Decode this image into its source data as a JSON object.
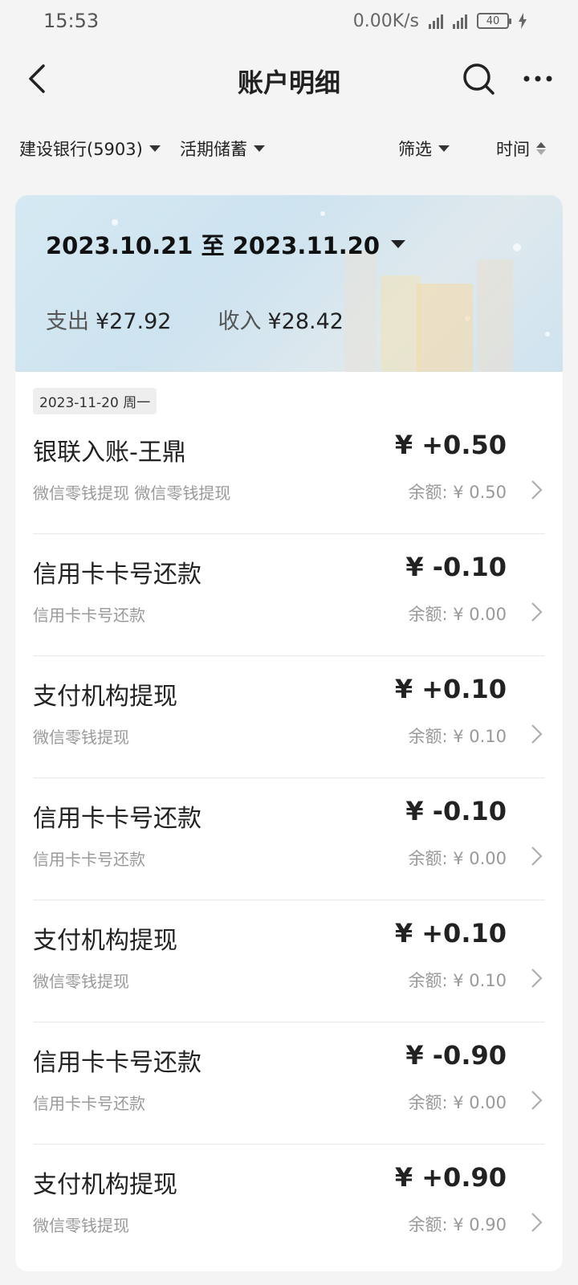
{
  "status": {
    "time": "15:53",
    "speed": "0.00K/s",
    "battery": "40"
  },
  "nav": {
    "title": "账户明细"
  },
  "filters": {
    "bank": "建设银行(5903)",
    "type": "活期储蓄",
    "filter": "筛选",
    "time": "时间"
  },
  "summary": {
    "range": "2023.10.21 至 2023.11.20",
    "expense_label": "支出",
    "expense": "¥27.92",
    "income_label": "收入",
    "income": "¥28.42"
  },
  "date_group": "2023-11-20 周一",
  "transactions": [
    {
      "name": "银联入账-王鼎",
      "sub": "微信零钱提现 微信零钱提现",
      "amount": "¥ +0.50",
      "balance": "余额: ¥ 0.50"
    },
    {
      "name": "信用卡卡号还款",
      "sub": "信用卡卡号还款",
      "amount": "¥ -0.10",
      "balance": "余额: ¥ 0.00"
    },
    {
      "name": "支付机构提现",
      "sub": "微信零钱提现",
      "amount": "¥ +0.10",
      "balance": "余额: ¥ 0.10"
    },
    {
      "name": "信用卡卡号还款",
      "sub": "信用卡卡号还款",
      "amount": "¥ -0.10",
      "balance": "余额: ¥ 0.00"
    },
    {
      "name": "支付机构提现",
      "sub": "微信零钱提现",
      "amount": "¥ +0.10",
      "balance": "余额: ¥ 0.10"
    },
    {
      "name": "信用卡卡号还款",
      "sub": "信用卡卡号还款",
      "amount": "¥ -0.90",
      "balance": "余额: ¥ 0.00"
    },
    {
      "name": "支付机构提现",
      "sub": "微信零钱提现",
      "amount": "¥ +0.90",
      "balance": "余额: ¥ 0.90"
    }
  ]
}
